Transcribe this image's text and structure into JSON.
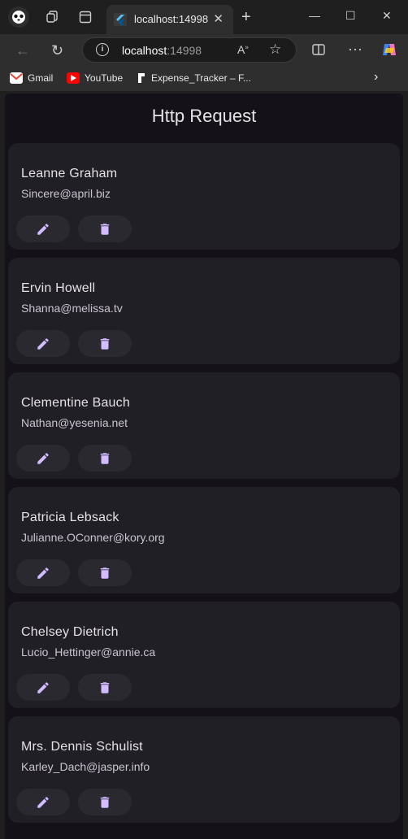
{
  "browser": {
    "tab_title": "localhost:14998",
    "url_host": "localhost",
    "url_port": ":14998",
    "bookmarks": [
      {
        "label": "Gmail",
        "icon": "gmail-icon",
        "color": "#ea4335"
      },
      {
        "label": "YouTube",
        "icon": "youtube-icon",
        "color": "#ff0000"
      },
      {
        "label": "Expense_Tracker – F...",
        "icon": "figma-icon",
        "color": "#ffffff"
      }
    ]
  },
  "app": {
    "title": "Http Request",
    "accent": "#d0bcff",
    "users": [
      {
        "name": "Leanne Graham",
        "email": "Sincere@april.biz"
      },
      {
        "name": "Ervin Howell",
        "email": "Shanna@melissa.tv"
      },
      {
        "name": "Clementine Bauch",
        "email": "Nathan@yesenia.net"
      },
      {
        "name": "Patricia Lebsack",
        "email": "Julianne.OConner@kory.org"
      },
      {
        "name": "Chelsey Dietrich",
        "email": "Lucio_Hettinger@annie.ca"
      },
      {
        "name": "Mrs. Dennis Schulist",
        "email": "Karley_Dach@jasper.info"
      }
    ]
  }
}
